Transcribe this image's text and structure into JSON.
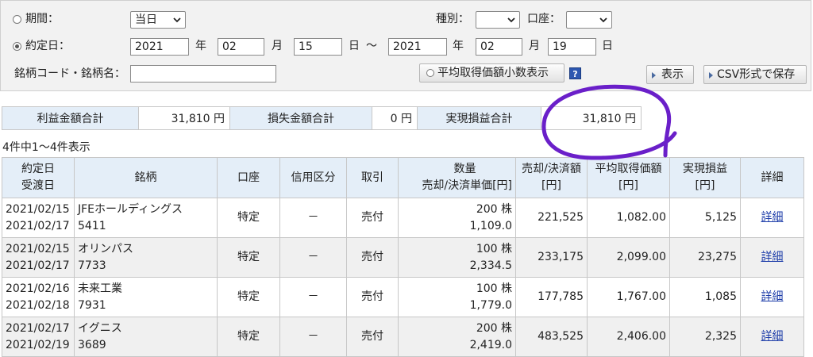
{
  "search": {
    "period_label": "期間：",
    "period_select": "当日",
    "contract_date_label": "約定日：",
    "from_year": "2021",
    "from_month": "02",
    "from_day": "15",
    "to_year": "2021",
    "to_month": "02",
    "to_day": "19",
    "unit_year": "年",
    "unit_month": "月",
    "unit_day": "日",
    "tilde": "〜",
    "type_label": "種別：",
    "type_select": "",
    "account_label": "口座：",
    "account_select": "",
    "code_label": "銘柄コード・銘柄名：",
    "code_value": "",
    "avg_decimal_button": "平均取得価額小数表示",
    "help_icon": "?",
    "display_button": "表示",
    "csv_button": "CSV形式で保存"
  },
  "summary": {
    "profit_label": "利益金額合計",
    "profit_value": "31,810 円",
    "loss_label": "損失金額合計",
    "loss_value": "0 円",
    "realized_label": "実現損益合計",
    "realized_value": "31,810 円"
  },
  "count_text": "4件中1〜4件表示",
  "table": {
    "headers": {
      "date": [
        "約定日",
        "受渡日"
      ],
      "name": "銘柄",
      "account": "口座",
      "margin": "信用区分",
      "trade": "取引",
      "qty": [
        "数量",
        "売却/決済単価[円]"
      ],
      "amount": [
        "売却/決済額",
        "[円]"
      ],
      "avg": [
        "平均取得価額",
        "[円]"
      ],
      "pl": [
        "実現損益",
        "[円]"
      ],
      "detail": "詳細"
    },
    "rows": [
      {
        "trade_date": "2021/02/15",
        "settle_date": "2021/02/17",
        "name": "JFEホールディングス",
        "code": "5411",
        "account": "特定",
        "margin": "－",
        "trade": "売付",
        "qty": "200 株",
        "price": "1,109.0",
        "amount": "221,525",
        "avg": "1,082.00",
        "pl": "5,125",
        "detail": "詳細"
      },
      {
        "trade_date": "2021/02/15",
        "settle_date": "2021/02/17",
        "name": "オリンパス",
        "code": "7733",
        "account": "特定",
        "margin": "－",
        "trade": "売付",
        "qty": "100 株",
        "price": "2,334.5",
        "amount": "233,175",
        "avg": "2,099.00",
        "pl": "23,275",
        "detail": "詳細"
      },
      {
        "trade_date": "2021/02/16",
        "settle_date": "2021/02/18",
        "name": "未来工業",
        "code": "7931",
        "account": "特定",
        "margin": "－",
        "trade": "売付",
        "qty": "100 株",
        "price": "1,779.0",
        "amount": "177,785",
        "avg": "1,767.00",
        "pl": "1,085",
        "detail": "詳細"
      },
      {
        "trade_date": "2021/02/17",
        "settle_date": "2021/02/19",
        "name": "イグニス",
        "code": "3689",
        "account": "特定",
        "margin": "－",
        "trade": "売付",
        "qty": "200 株",
        "price": "2,419.0",
        "amount": "483,525",
        "avg": "2,406.00",
        "pl": "2,325",
        "detail": "詳細"
      }
    ]
  },
  "colors": {
    "annotation": "#6a1fc9",
    "header_bg": "#e4eef8",
    "link": "#1a3aa8"
  }
}
